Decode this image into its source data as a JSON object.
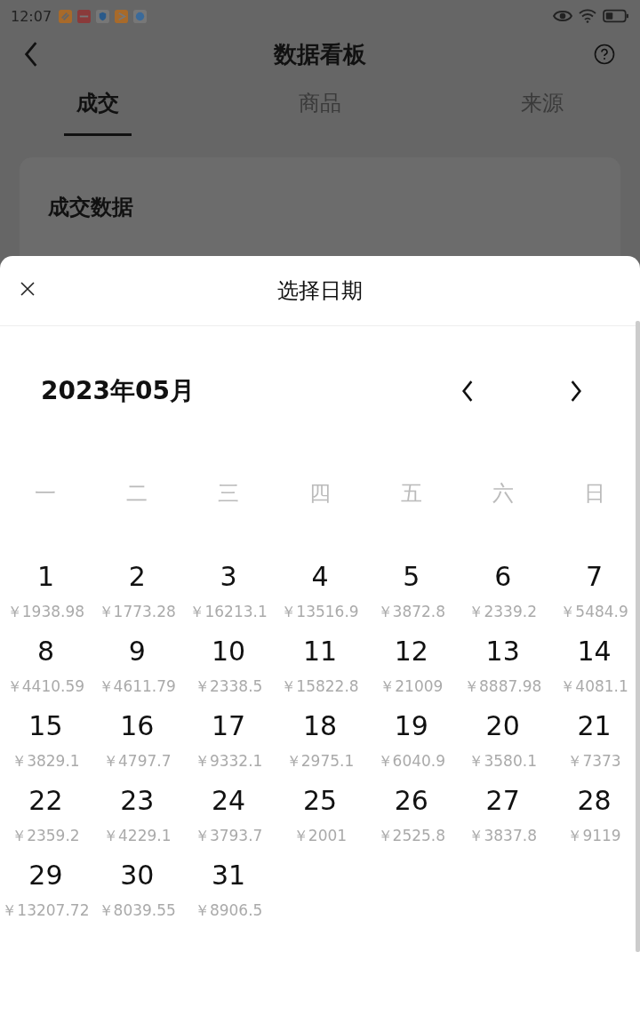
{
  "status_bar": {
    "time": "12:07"
  },
  "header": {
    "title": "数据看板"
  },
  "tabs": [
    {
      "label": "成交",
      "selected": true
    },
    {
      "label": "商品",
      "selected": false
    },
    {
      "label": "来源",
      "selected": false
    }
  ],
  "card": {
    "title": "成交数据"
  },
  "sheet": {
    "title": "选择日期",
    "month": "2023年05月",
    "weekdays": [
      "一",
      "二",
      "三",
      "四",
      "五",
      "六",
      "日"
    ],
    "days": [
      {
        "day": "1",
        "amount": "￥1938.98"
      },
      {
        "day": "2",
        "amount": "￥1773.28"
      },
      {
        "day": "3",
        "amount": "￥16213.1"
      },
      {
        "day": "4",
        "amount": "￥13516.9"
      },
      {
        "day": "5",
        "amount": "￥3872.8"
      },
      {
        "day": "6",
        "amount": "￥2339.2"
      },
      {
        "day": "7",
        "amount": "￥5484.9"
      },
      {
        "day": "8",
        "amount": "￥4410.59"
      },
      {
        "day": "9",
        "amount": "￥4611.79"
      },
      {
        "day": "10",
        "amount": "￥2338.5"
      },
      {
        "day": "11",
        "amount": "￥15822.8"
      },
      {
        "day": "12",
        "amount": "￥21009"
      },
      {
        "day": "13",
        "amount": "￥8887.98"
      },
      {
        "day": "14",
        "amount": "￥4081.1"
      },
      {
        "day": "15",
        "amount": "￥3829.1"
      },
      {
        "day": "16",
        "amount": "￥4797.7"
      },
      {
        "day": "17",
        "amount": "￥9332.1"
      },
      {
        "day": "18",
        "amount": "￥2975.1"
      },
      {
        "day": "19",
        "amount": "￥6040.9"
      },
      {
        "day": "20",
        "amount": "￥3580.1"
      },
      {
        "day": "21",
        "amount": "￥7373"
      },
      {
        "day": "22",
        "amount": "￥2359.2"
      },
      {
        "day": "23",
        "amount": "￥4229.1"
      },
      {
        "day": "24",
        "amount": "￥3793.7"
      },
      {
        "day": "25",
        "amount": "￥2001"
      },
      {
        "day": "26",
        "amount": "￥2525.8"
      },
      {
        "day": "27",
        "amount": "￥3837.8"
      },
      {
        "day": "28",
        "amount": "￥9119"
      },
      {
        "day": "29",
        "amount": "￥13207.72"
      },
      {
        "day": "30",
        "amount": "￥8039.55"
      },
      {
        "day": "31",
        "amount": "￥8906.5"
      }
    ]
  }
}
